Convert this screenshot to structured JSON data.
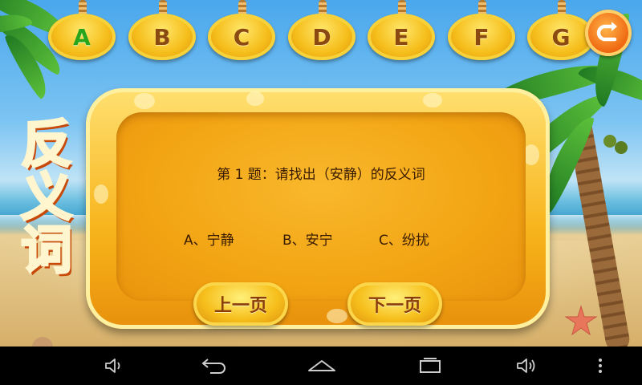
{
  "header": {
    "letters": [
      {
        "label": "A",
        "active": true
      },
      {
        "label": "B",
        "active": false
      },
      {
        "label": "C",
        "active": false
      },
      {
        "label": "D",
        "active": false
      },
      {
        "label": "E",
        "active": false
      },
      {
        "label": "F",
        "active": false
      },
      {
        "label": "G",
        "active": false
      }
    ],
    "back_icon": "return-arrow-icon"
  },
  "title": {
    "chars": [
      "反",
      "义",
      "词"
    ]
  },
  "question": {
    "text": "第 1 题：请找出（安静）的反义词",
    "options": [
      "A、宁静",
      "B、安宁",
      "C、纷扰"
    ]
  },
  "buttons": {
    "prev": "上一页",
    "next": "下一页"
  },
  "system_nav": {
    "icons": [
      "volume-down-icon",
      "back-icon",
      "home-icon",
      "recent-apps-icon",
      "volume-up-icon",
      "menu-dots-icon"
    ]
  },
  "colors": {
    "accent": "#f6bf1c",
    "active_letter": "#29a51d",
    "text": "#3a1c00"
  }
}
